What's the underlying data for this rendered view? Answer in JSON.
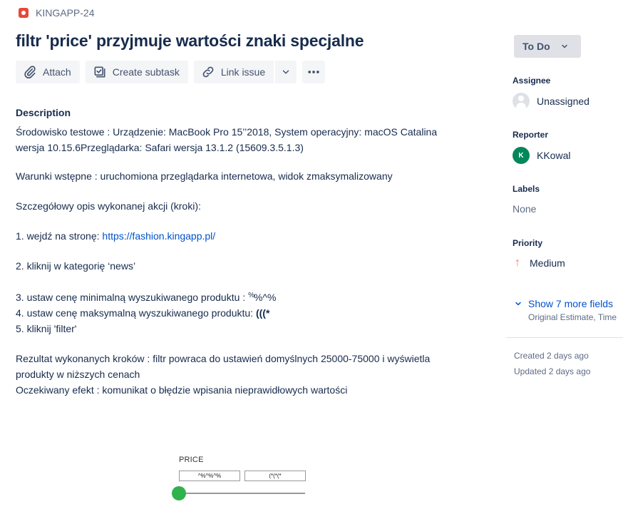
{
  "issue": {
    "key": "KINGAPP-24",
    "title": "filtr 'price' przyjmuje wartości znaki specjalne"
  },
  "toolbar": {
    "attach_label": "Attach",
    "create_subtask_label": "Create subtask",
    "link_issue_label": "Link issue"
  },
  "description": {
    "heading": "Description",
    "env_line1": "Środowisko testowe : Urządzenie: MacBook Pro 15’’2018, System operacyjny: macOS Catalina",
    "env_line2": "wersja 10.15.6Przeglądarka: Safari wersja 13.1.2 (15609.3.5.1.3)",
    "conditions": "Warunki wstępne : uruchomiona przeglądarka internetowa, widok zmaksymalizowany",
    "steps_heading": "Szczegółowy opis wykonanej akcji (kroki):",
    "step1_prefix": "1. wejdź na stronę: ",
    "step1_link": "https://fashion.kingapp.pl/",
    "step2": "2. kliknij w kategorię ‘news’",
    "step3_prefix": "3. ustaw cenę minimalną wyszukiwanego produktu : ",
    "step3_sup": "%",
    "step3_value": "%^%",
    "step4_prefix": "4. ustaw cenę maksymalną wyszukiwanego produktu: ",
    "step4_value": "(((*",
    "step5": "5. kliknij 'filter'",
    "result_line1": "Rezultat wykonanych kroków :  filtr powraca do ustawień domyślnych 25000-75000 i wyświetla",
    "result_line2": "produkty w niższych cenach",
    "expected": "Oczekiwany efekt : komunikat o błędzie wpisania nieprawidłowych wartości"
  },
  "price_widget": {
    "label": "PRICE",
    "min_value": "^%^%^%",
    "max_value": "(*(*(*",
    "slider_color": "#2fb24c"
  },
  "sidebar": {
    "status": "To Do",
    "assignee_label": "Assignee",
    "assignee_value": "Unassigned",
    "reporter_label": "Reporter",
    "reporter_initial": "K",
    "reporter_value": "KKowal",
    "labels_label": "Labels",
    "labels_value": "None",
    "priority_label": "Priority",
    "priority_value": "Medium",
    "show_more_label": "Show 7 more fields",
    "show_more_sub": "Original Estimate, Time",
    "created": "Created 2 days ago",
    "updated": "Updated 2 days ago"
  },
  "colors": {
    "link": "#0052cc",
    "bug": "#e5493a",
    "priority_medium": "#ff7452",
    "reporter_avatar": "#00875a"
  }
}
